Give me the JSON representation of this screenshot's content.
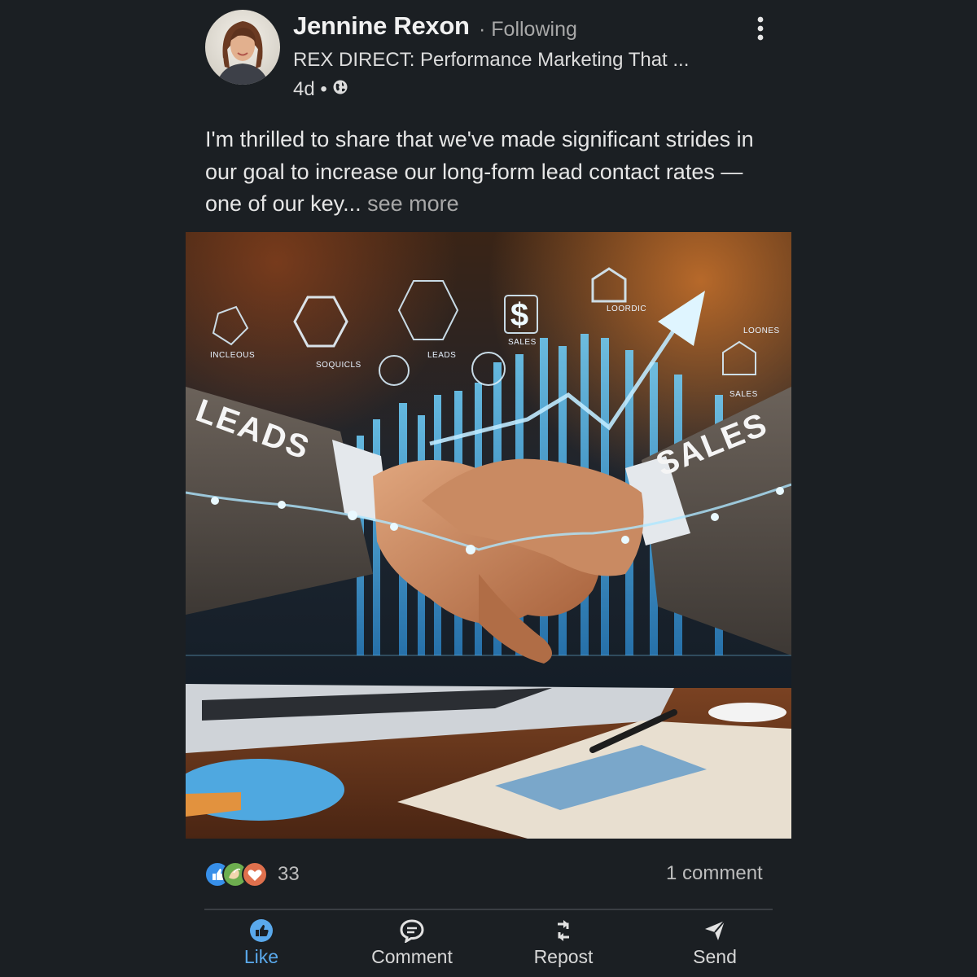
{
  "author": {
    "name": "Jennine Rexon",
    "follow_status": "· Following",
    "headline": "REX DIRECT: Performance Marketing That ...",
    "time": "4d •"
  },
  "post": {
    "text": "I'm thrilled to share that we've made significant strides in our goal to increase our long-form lead contact rates — one of our key...",
    "see_more": "see more",
    "image": {
      "left_sleeve_text": "LEADS",
      "right_sleeve_text": "SALES",
      "icon_labels": [
        "INCLEOUS",
        "SOQUICLS",
        "LEADS",
        "SALES",
        "LOORDIC",
        "LOONES",
        "SALES"
      ]
    }
  },
  "social": {
    "reaction_count": "33",
    "comment_count": "1 comment"
  },
  "actions": {
    "like": "Like",
    "comment": "Comment",
    "repost": "Repost",
    "send": "Send"
  },
  "colors": {
    "background": "#1b1f23",
    "accent_blue": "#5aa9ec",
    "muted_text": "#a8a8a8"
  },
  "icons": [
    "more-vertical-icon",
    "globe-icon",
    "like-reaction-icon",
    "celebrate-reaction-icon",
    "love-reaction-icon",
    "like-icon",
    "comment-icon",
    "repost-icon",
    "send-icon"
  ]
}
